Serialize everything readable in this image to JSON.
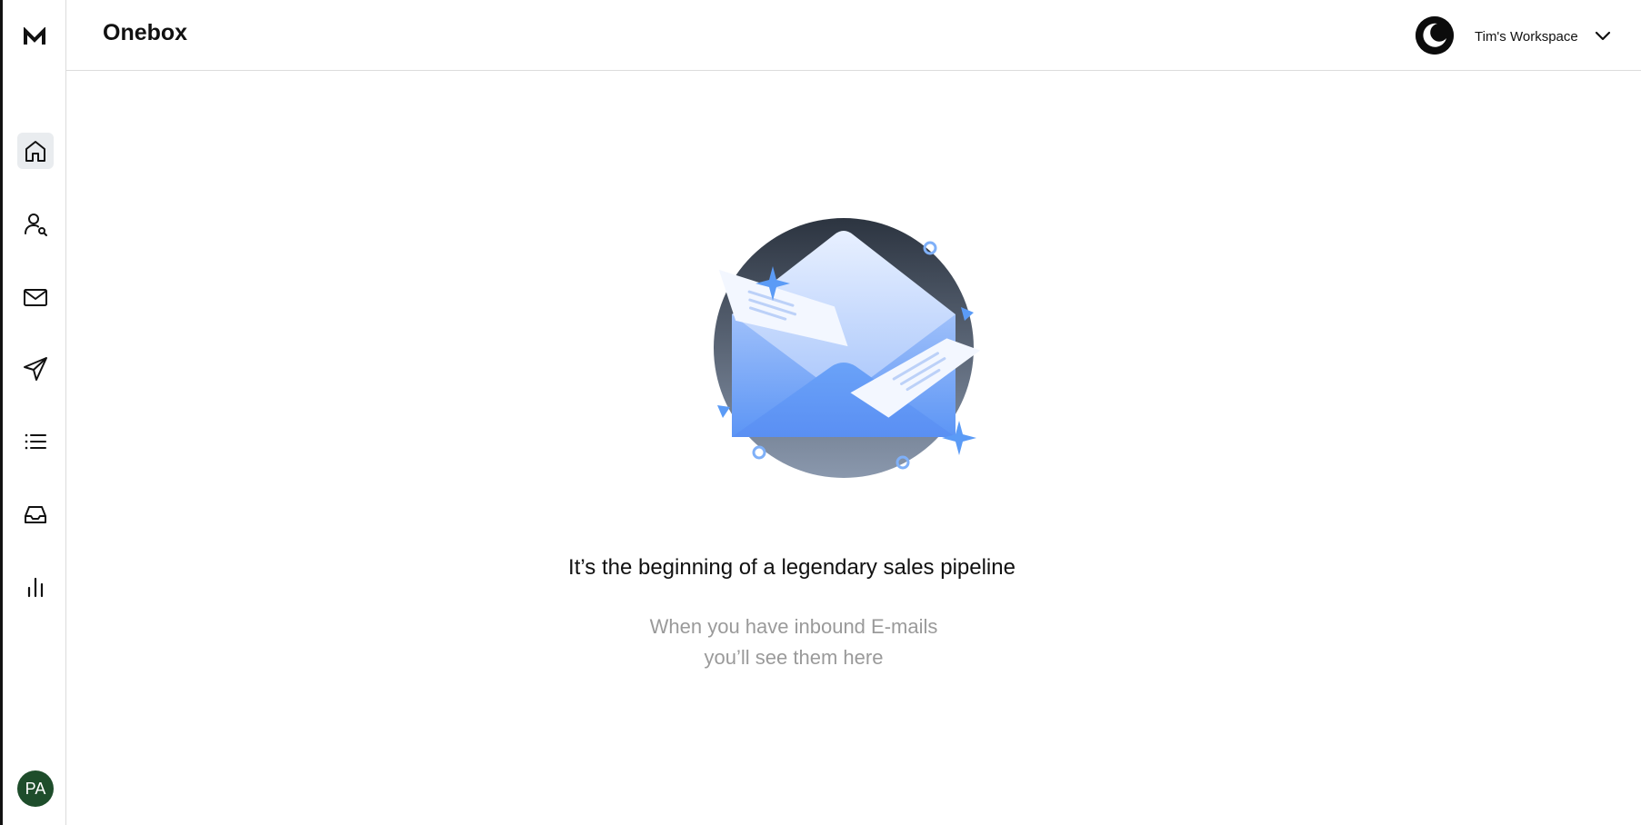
{
  "app": {
    "logo_text": "M",
    "page_title": "Onebox"
  },
  "sidebar": {
    "items": [
      {
        "name": "home",
        "icon": "home-icon",
        "active": true
      },
      {
        "name": "leads",
        "icon": "user-search-icon",
        "active": false
      },
      {
        "name": "mail",
        "icon": "mail-icon",
        "active": false
      },
      {
        "name": "campaigns",
        "icon": "send-icon",
        "active": false
      },
      {
        "name": "lists",
        "icon": "list-icon",
        "active": false
      },
      {
        "name": "onebox",
        "icon": "inbox-icon",
        "active": false
      },
      {
        "name": "analytics",
        "icon": "bar-chart-icon",
        "active": false
      }
    ],
    "avatar_initials": "PA"
  },
  "header": {
    "theme_toggle_icon": "moon-icon",
    "workspace_name": "Tim's Workspace",
    "workspace_dropdown_icon": "chevron-down-icon"
  },
  "empty_state": {
    "illustration": "open-envelope-illustration",
    "title": "It’s the beginning of a legendary sales pipeline",
    "subtitle_line1": "When you have inbound E-mails",
    "subtitle_line2": "you’ll see them here"
  },
  "colors": {
    "accent_blue": "#5b9bf6",
    "avatar_bg": "#1e4d2b",
    "muted_text": "#9a9a9a"
  }
}
